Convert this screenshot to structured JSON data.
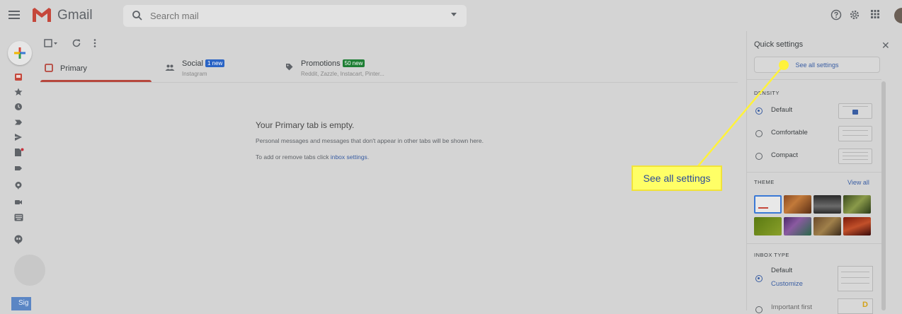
{
  "header": {
    "app_title": "Gmail",
    "search_placeholder": "Search mail",
    "icons": [
      "menu-icon",
      "gmail-logo",
      "search-icon",
      "help-icon",
      "settings-icon",
      "apps-icon"
    ]
  },
  "tabs": [
    {
      "label": "Primary",
      "sub": "",
      "badge": ""
    },
    {
      "label": "Social",
      "sub": "Instagram",
      "badge": "1 new",
      "badge_color": "#2a64c5"
    },
    {
      "label": "Promotions",
      "sub": "Reddit, Zazzle, Instacart, Pinter...",
      "badge": "50 new",
      "badge_color": "#1e7e34"
    }
  ],
  "empty_state": {
    "title": "Your Primary tab is empty.",
    "line1": "Personal messages and messages that don't appear in other tabs will be shown here.",
    "line2_prefix": "To add or remove tabs click ",
    "line2_link": "inbox settings",
    "line2_suffix": "."
  },
  "quick_settings": {
    "title": "Quick settings",
    "see_all": "See all settings",
    "density_label": "DENSITY",
    "density_options": [
      "Default",
      "Comfortable",
      "Compact"
    ],
    "density_selected": "Default",
    "theme_label": "THEME",
    "view_all": "View all",
    "inbox_type_label": "INBOX TYPE",
    "inbox_default": "Default",
    "customize": "Customize",
    "important_first": "Important first"
  },
  "callout": {
    "text": "See all settings"
  },
  "sign_tab": "Sig",
  "colors": {
    "primary_tab_accent": "#b6473d",
    "link": "#3a5ea3",
    "callout_yellow": "#ffff66"
  }
}
